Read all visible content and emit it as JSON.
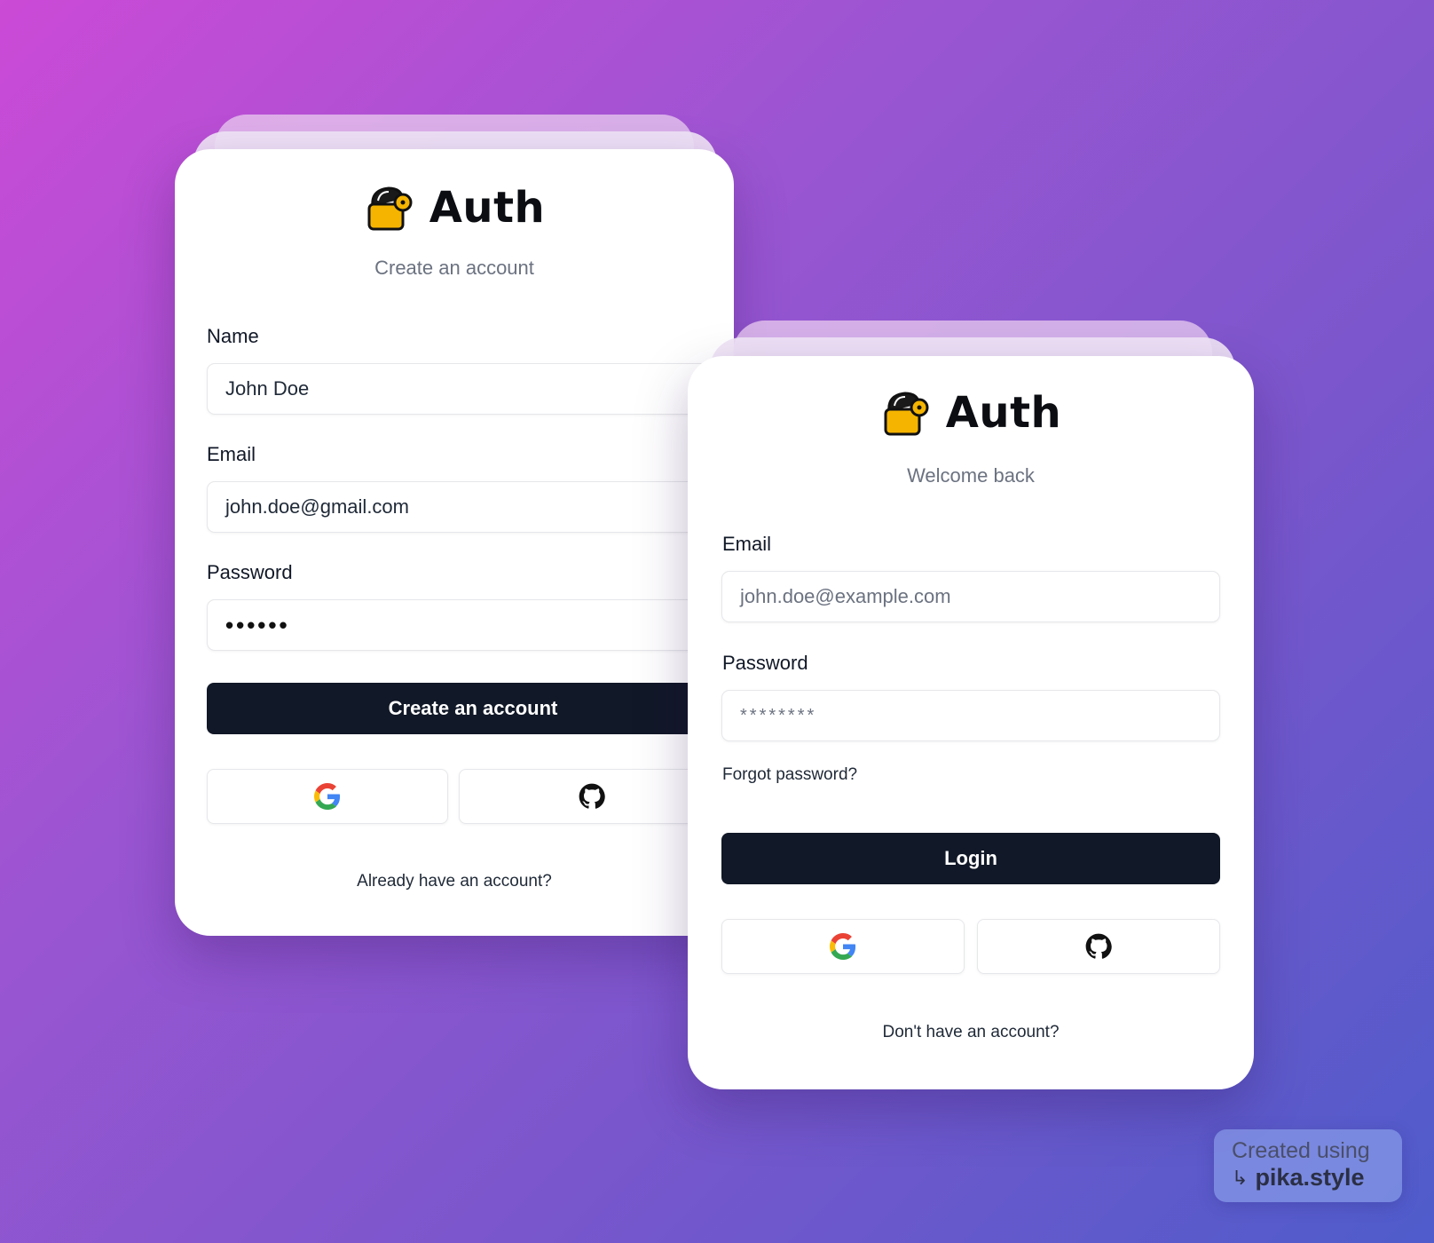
{
  "signup": {
    "brand": "Auth",
    "subtitle": "Create an account",
    "name_label": "Name",
    "name_value": "John Doe",
    "email_label": "Email",
    "email_value": "john.doe@gmail.com",
    "password_label": "Password",
    "password_value": "••••••",
    "submit_label": "Create an account",
    "footer_link": "Already have an account?"
  },
  "login": {
    "brand": "Auth",
    "subtitle": "Welcome back",
    "email_label": "Email",
    "email_placeholder": "john.doe@example.com",
    "password_label": "Password",
    "password_placeholder": "********",
    "forgot_link": "Forgot password?",
    "submit_label": "Login",
    "footer_link": "Don't have an account?"
  },
  "social": {
    "google_icon": "google-icon",
    "github_icon": "github-icon"
  },
  "watermark": {
    "line1": "Created using",
    "line2": "pika.style",
    "arrow_icon": "arrow-return-icon"
  },
  "colors": {
    "primary_button": "#111827",
    "logo_yellow": "#f5b400",
    "background_start": "#cb4ad6",
    "background_end": "#4f5ccb"
  }
}
